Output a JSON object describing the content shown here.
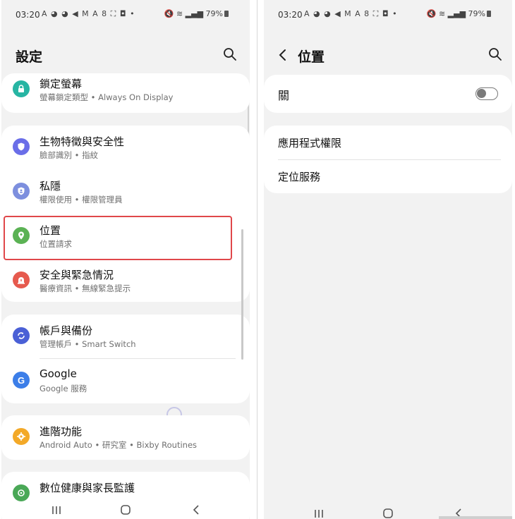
{
  "status_bar": {
    "time": "03:20",
    "notification_icons": "A ◕ ◕ ◀ M A 8 ⛶ ◘ •",
    "battery_percent": "79%"
  },
  "left_screen": {
    "title": "設定",
    "items": [
      {
        "title": "鎖定螢幕",
        "subtitle": "螢幕鎖定類型 • Always On Display",
        "icon": "lock-icon",
        "color": "#27b5a3"
      },
      {
        "title": "生物特徵與安全性",
        "subtitle": "臉部識別 • 指紋",
        "icon": "shield-icon",
        "color": "#6a6ee8"
      },
      {
        "title": "私隱",
        "subtitle": "權限使用 • 權限管理員",
        "icon": "privacy-shield-icon",
        "color": "#7d8fde"
      },
      {
        "title": "位置",
        "subtitle": "位置請求",
        "icon": "location-pin-icon",
        "color": "#5bb254"
      },
      {
        "title": "安全與緊急情況",
        "subtitle": "醫療資訊 • 無線緊急提示",
        "icon": "emergency-alert-icon",
        "color": "#e65a4e"
      },
      {
        "title": "帳戶與備份",
        "subtitle": "管理帳戶 • Smart Switch",
        "icon": "sync-icon",
        "color": "#4a60d6"
      },
      {
        "title": "Google",
        "subtitle": "Google 服務",
        "icon": "google-icon",
        "color": "#3c7ee8"
      },
      {
        "title": "進階功能",
        "subtitle": "Android Auto • 研究室 • Bixby Routines",
        "icon": "gear-plus-icon",
        "color": "#f3a928"
      },
      {
        "title": "數位健康與家長監護",
        "subtitle": "",
        "icon": "digital-wellbeing-icon",
        "color": "#4aa857"
      }
    ]
  },
  "right_screen": {
    "title": "位置",
    "master_toggle": {
      "label": "關",
      "state": "off"
    },
    "items": [
      {
        "title": "應用程式權限"
      },
      {
        "title": "定位服務"
      }
    ]
  },
  "colors": {
    "highlight": "#e0474a",
    "background": "#f2f2f2"
  }
}
